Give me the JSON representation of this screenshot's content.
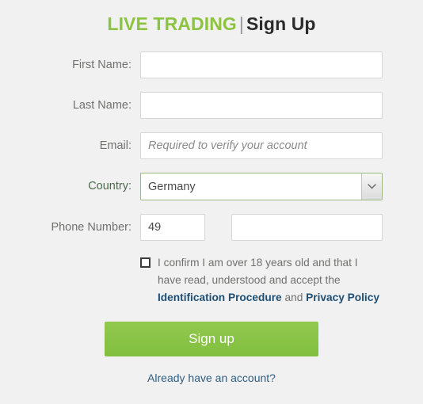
{
  "header": {
    "title_primary": "LIVE TRADING",
    "title_separator": "|",
    "title_secondary": "Sign Up",
    "primary_color": "#8cc440",
    "secondary_color": "#2b2b2b"
  },
  "form": {
    "first_name": {
      "label": "First Name:",
      "value": "",
      "placeholder": ""
    },
    "last_name": {
      "label": "Last Name:",
      "value": "",
      "placeholder": ""
    },
    "email": {
      "label": "Email:",
      "value": "",
      "placeholder": "Required to verify your account"
    },
    "country": {
      "label": "Country:",
      "selected": "Germany",
      "icon": "chevron-down-icon",
      "accent_color": "#9cb77f"
    },
    "phone": {
      "label": "Phone Number:",
      "country_code": "49",
      "code_placeholder": "",
      "number": "",
      "number_placeholder": ""
    }
  },
  "consent": {
    "checked": false,
    "text_part_1": "I confirm I am over 18 years old and that I have read, understood and accept the ",
    "link_1": "Identification Procedure",
    "text_part_2": " and ",
    "link_2": "Privacy Policy",
    "link_color": "#1f4f74"
  },
  "actions": {
    "submit_label": "Sign up",
    "submit_color": "#8cc440",
    "footer_link": "Already have an account?",
    "footer_link_color": "#2f5d80"
  }
}
